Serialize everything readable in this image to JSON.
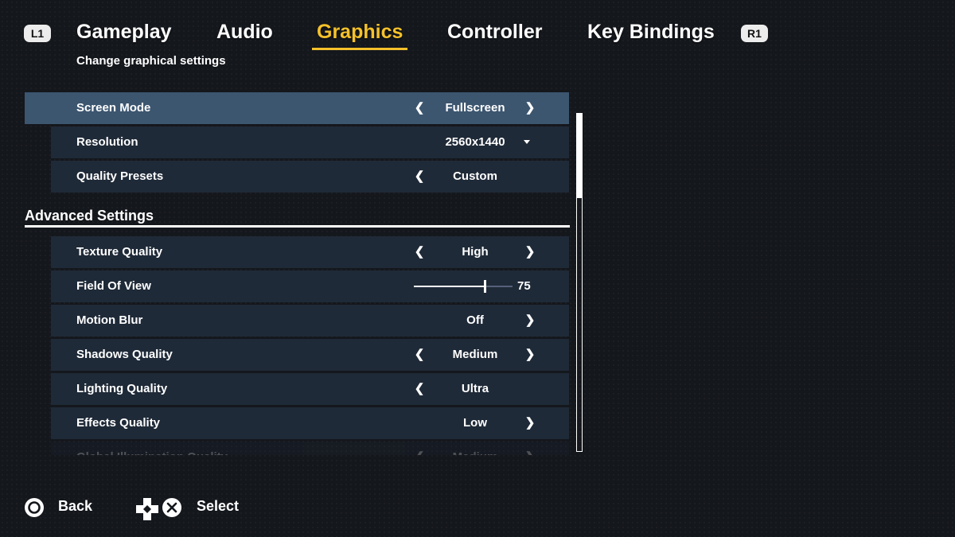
{
  "header": {
    "bumper_left": "L1",
    "bumper_right": "R1",
    "tabs": [
      {
        "label": "Gameplay"
      },
      {
        "label": "Audio"
      },
      {
        "label": "Graphics"
      },
      {
        "label": "Controller"
      },
      {
        "label": "Key Bindings"
      }
    ],
    "active_tab": "Graphics",
    "subtitle": "Change graphical settings"
  },
  "settings": {
    "screen_mode": {
      "label": "Screen Mode",
      "value": "Fullscreen"
    },
    "resolution": {
      "label": "Resolution",
      "value": "2560x1440"
    },
    "quality_presets": {
      "label": "Quality Presets",
      "value": "Custom"
    },
    "section_title": "Advanced Settings",
    "texture_quality": {
      "label": "Texture Quality",
      "value": "High"
    },
    "field_of_view": {
      "label": "Field Of View",
      "value": "75",
      "slider_fraction": 0.72
    },
    "motion_blur": {
      "label": "Motion Blur",
      "value": "Off"
    },
    "shadows_quality": {
      "label": "Shadows Quality",
      "value": "Medium"
    },
    "lighting_quality": {
      "label": "Lighting Quality",
      "value": "Ultra"
    },
    "effects_quality": {
      "label": "Effects Quality",
      "value": "Low"
    },
    "global_illumination_quality": {
      "label": "Global Illumination Quality",
      "value": "Medium"
    }
  },
  "scroll": {
    "thumb_fraction": 0.25
  },
  "footer": {
    "back_label": "Back",
    "select_label": "Select"
  },
  "colors": {
    "accent": "#f5c12b",
    "row_bg": "#1f2a38",
    "row_selected_bg": "#3c5670",
    "background": "#14171c"
  }
}
